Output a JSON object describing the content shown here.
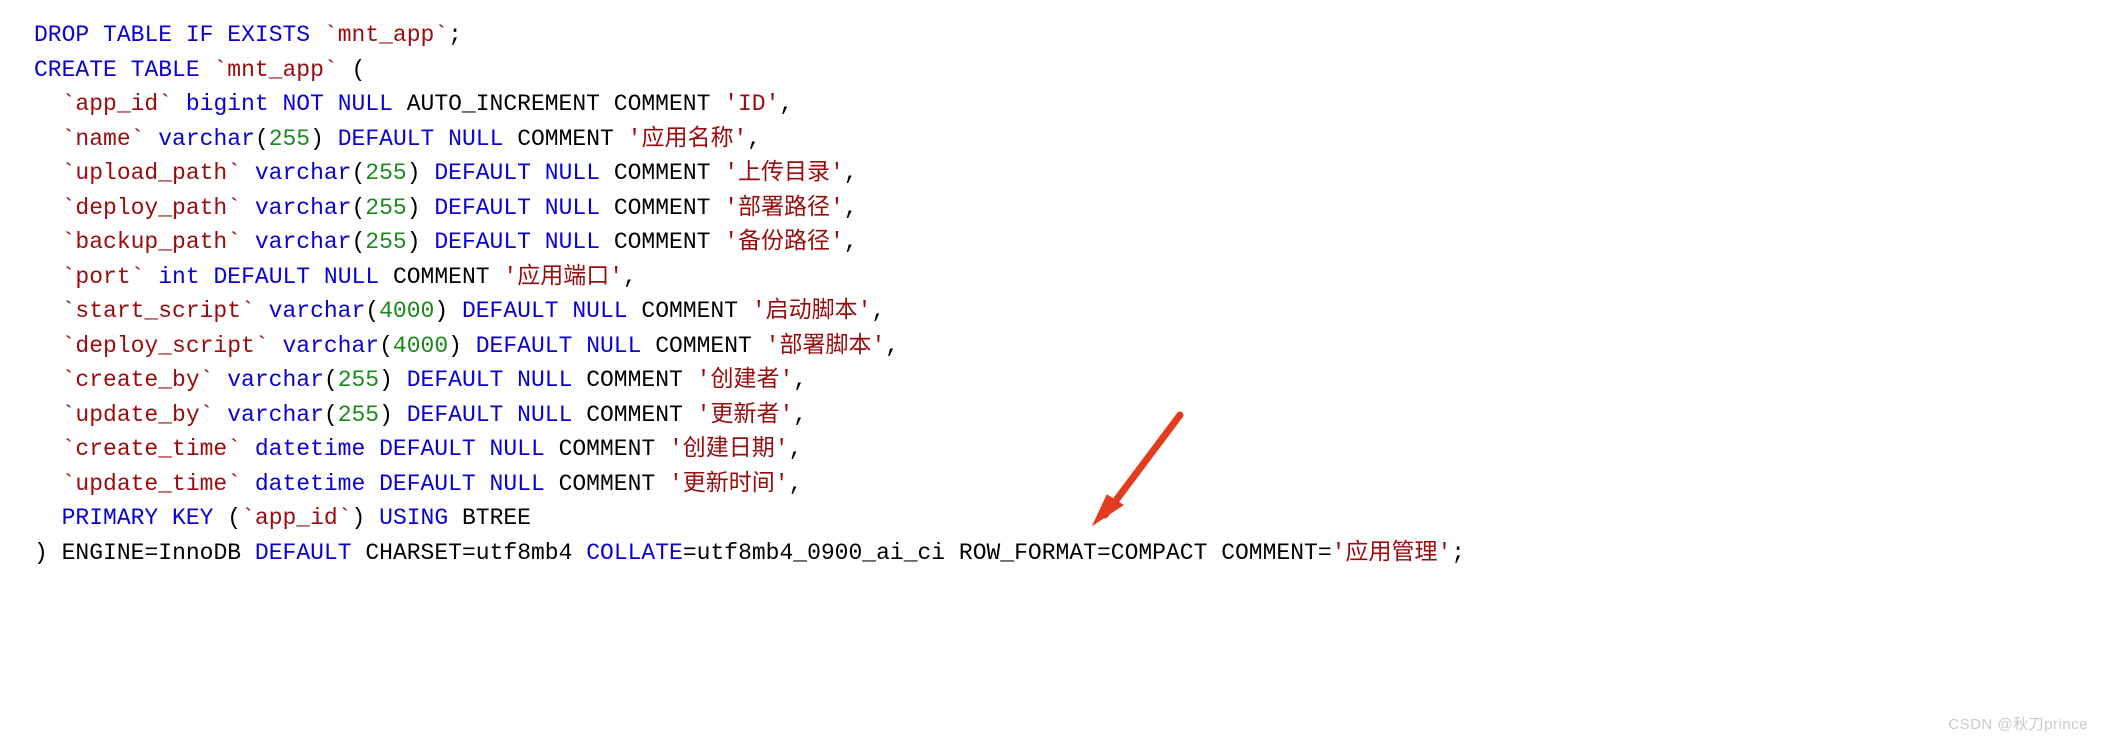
{
  "watermark": "CSDN @秋刀prince",
  "sql": {
    "drop": {
      "k_drop": "DROP",
      "k_table": "TABLE",
      "k_if": "IF",
      "k_exists": "EXISTS",
      "tbl": "`mnt_app`"
    },
    "create": {
      "k_create": "CREATE",
      "k_table": "TABLE",
      "tbl": "`mnt_app`",
      "open": "("
    },
    "cols": [
      {
        "name": "`app_id`",
        "type": "bigint",
        "num": "",
        "default": "",
        "k_notnull": "NOT NULL",
        "extra": "AUTO_INCREMENT",
        "k_comment": "COMMENT",
        "comment": "'ID'"
      },
      {
        "name": "`name`",
        "type": "varchar",
        "num": "255",
        "k_default": "DEFAULT",
        "k_null": "NULL",
        "k_comment": "COMMENT",
        "comment": "'应用名称'"
      },
      {
        "name": "`upload_path`",
        "type": "varchar",
        "num": "255",
        "k_default": "DEFAULT",
        "k_null": "NULL",
        "k_comment": "COMMENT",
        "comment": "'上传目录'"
      },
      {
        "name": "`deploy_path`",
        "type": "varchar",
        "num": "255",
        "k_default": "DEFAULT",
        "k_null": "NULL",
        "k_comment": "COMMENT",
        "comment": "'部署路径'"
      },
      {
        "name": "`backup_path`",
        "type": "varchar",
        "num": "255",
        "k_default": "DEFAULT",
        "k_null": "NULL",
        "k_comment": "COMMENT",
        "comment": "'备份路径'"
      },
      {
        "name": "`port`",
        "type": "int",
        "num": "",
        "k_default": "DEFAULT",
        "k_null": "NULL",
        "k_comment": "COMMENT",
        "comment": "'应用端口'"
      },
      {
        "name": "`start_script`",
        "type": "varchar",
        "num": "4000",
        "k_default": "DEFAULT",
        "k_null": "NULL",
        "k_comment": "COMMENT",
        "comment": "'启动脚本'"
      },
      {
        "name": "`deploy_script`",
        "type": "varchar",
        "num": "4000",
        "k_default": "DEFAULT",
        "k_null": "NULL",
        "k_comment": "COMMENT",
        "comment": "'部署脚本'"
      },
      {
        "name": "`create_by`",
        "type": "varchar",
        "num": "255",
        "k_default": "DEFAULT",
        "k_null": "NULL",
        "k_comment": "COMMENT",
        "comment": "'创建者'"
      },
      {
        "name": "`update_by`",
        "type": "varchar",
        "num": "255",
        "k_default": "DEFAULT",
        "k_null": "NULL",
        "k_comment": "COMMENT",
        "comment": "'更新者'"
      },
      {
        "name": "`create_time`",
        "type": "datetime",
        "num": "",
        "k_default": "DEFAULT",
        "k_null": "NULL",
        "k_comment": "COMMENT",
        "comment": "'创建日期'"
      },
      {
        "name": "`update_time`",
        "type": "datetime",
        "num": "",
        "k_default": "DEFAULT",
        "k_null": "NULL",
        "k_comment": "COMMENT",
        "comment": "'更新时间'"
      }
    ],
    "pk": {
      "k_primary": "PRIMARY",
      "k_key": "KEY",
      "open": "(",
      "col": "`app_id`",
      "close": ")",
      "k_using": "USING",
      "method": "BTREE"
    },
    "tail": {
      "close": ")",
      "k_engine": "ENGINE",
      "eq1": "=",
      "engine": "InnoDB",
      "k_default": "DEFAULT",
      "k_charset": "CHARSET",
      "eq2": "=",
      "charset": "utf8mb4",
      "k_collate": "COLLATE",
      "eq3": "=",
      "collate": "utf8mb4_0900_ai_ci",
      "k_rowformat": "ROW_FORMAT",
      "eq4": "=",
      "rowformat": "COMPACT",
      "k_comment": "COMMENT",
      "eq5": "=",
      "comment": "'应用管理'"
    }
  }
}
